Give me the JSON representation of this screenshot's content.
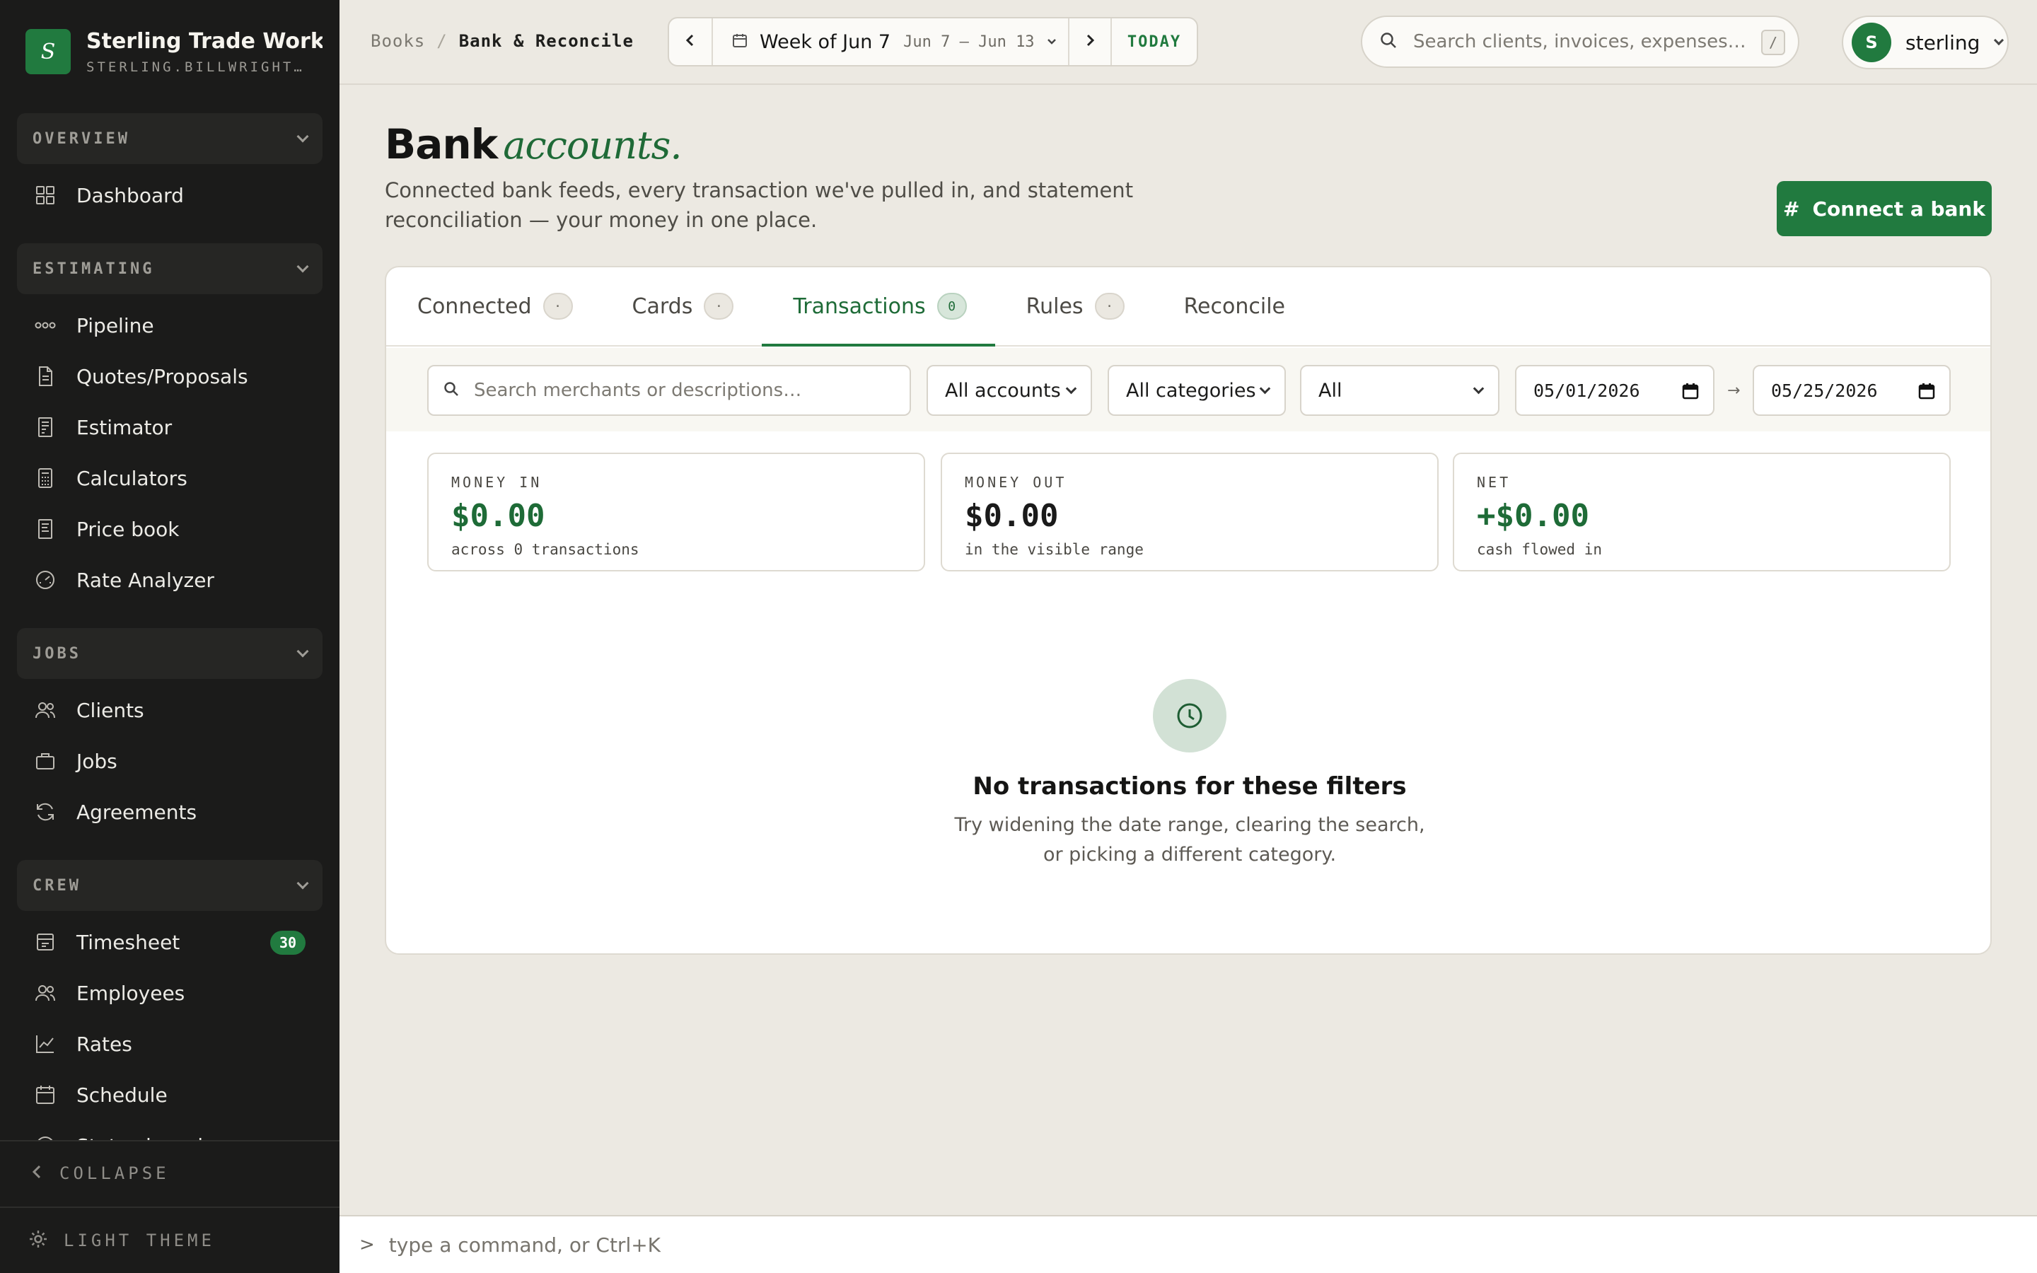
{
  "brand": {
    "logo_letter": "S",
    "name": "Sterling Trade Works",
    "subdomain": "STERLING.BILLWRIGHT.A…"
  },
  "sidebar": {
    "groups": [
      {
        "label": "OVERVIEW",
        "items": [
          {
            "label": "Dashboard",
            "icon": "grid-icon"
          }
        ]
      },
      {
        "label": "ESTIMATING",
        "items": [
          {
            "label": "Pipeline",
            "icon": "pipeline-icon"
          },
          {
            "label": "Quotes/Proposals",
            "icon": "document-icon"
          },
          {
            "label": "Estimator",
            "icon": "estimator-icon"
          },
          {
            "label": "Calculators",
            "icon": "calculator-icon"
          },
          {
            "label": "Price book",
            "icon": "price-book-icon"
          },
          {
            "label": "Rate Analyzer",
            "icon": "gauge-icon"
          }
        ]
      },
      {
        "label": "JOBS",
        "items": [
          {
            "label": "Clients",
            "icon": "users-icon"
          },
          {
            "label": "Jobs",
            "icon": "briefcase-icon"
          },
          {
            "label": "Agreements",
            "icon": "refresh-icon"
          }
        ]
      },
      {
        "label": "CREW",
        "items": [
          {
            "label": "Timesheet",
            "icon": "timesheet-icon",
            "badge": "30"
          },
          {
            "label": "Employees",
            "icon": "users-icon"
          },
          {
            "label": "Rates",
            "icon": "chart-line-icon"
          },
          {
            "label": "Schedule",
            "icon": "calendar-icon"
          },
          {
            "label": "Status board",
            "icon": "clock-icon"
          }
        ]
      }
    ],
    "collapse_label": "COLLAPSE",
    "theme_label": "LIGHT THEME"
  },
  "topbar": {
    "breadcrumb_root": "Books",
    "breadcrumb_sep": "/",
    "breadcrumb_current": "Bank & Reconcile",
    "week_title": "Week of Jun 7",
    "week_range": "Jun 7 – Jun 13",
    "today_label": "TODAY",
    "search_placeholder": "Search clients, invoices, expenses…",
    "search_shortcut": "/",
    "user_initial": "S",
    "user_name": "sterling"
  },
  "page": {
    "title": "Bank",
    "title_accent": "accounts.",
    "description": "Connected bank feeds, every transaction we've pulled in, and statement reconciliation — your money in one place.",
    "cta_label": "Connect a bank",
    "cta_icon": "#"
  },
  "tabs": [
    {
      "label": "Connected",
      "count": "·"
    },
    {
      "label": "Cards",
      "count": "·"
    },
    {
      "label": "Transactions",
      "count": "0",
      "active": true
    },
    {
      "label": "Rules",
      "count": "·"
    },
    {
      "label": "Reconcile"
    }
  ],
  "filters": {
    "search_placeholder": "Search merchants or descriptions…",
    "account": "All accounts",
    "category": "All categories",
    "status": "All",
    "date_from": "05/01/2026",
    "date_to": "05/25/2026",
    "range_arrow": "→"
  },
  "stats": {
    "money_in": {
      "label": "MONEY IN",
      "value": "$0.00",
      "desc": "across 0 transactions"
    },
    "money_out": {
      "label": "MONEY OUT",
      "value": "$0.00",
      "desc": "in the visible range"
    },
    "net": {
      "label": "NET",
      "value": "+$0.00",
      "desc": "cash flowed in"
    }
  },
  "empty_state": {
    "icon": "clock-icon",
    "title": "No transactions for these filters",
    "description": "Try widening the date range, clearing the search, or picking a different category."
  },
  "command_bar": {
    "prompt": ">",
    "placeholder": "type a command, or Ctrl+K"
  },
  "colors": {
    "accent": "#217a3f",
    "sidebar_bg": "#1b1b1a",
    "page_bg": "#ece9e2"
  }
}
